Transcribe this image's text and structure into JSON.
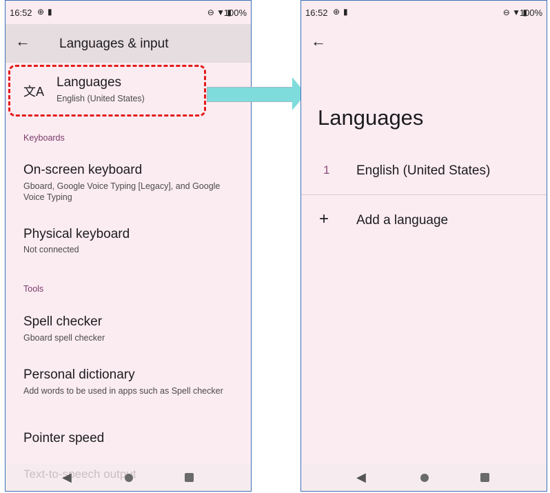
{
  "left": {
    "status": {
      "time": "16:52",
      "battery": "100%"
    },
    "appbar": {
      "title": "Languages & input"
    },
    "languages": {
      "title": "Languages",
      "subtitle": "English (United States)"
    },
    "sections": {
      "keyboards": "Keyboards",
      "tools": "Tools"
    },
    "items": [
      {
        "title": "On-screen keyboard",
        "subtitle": "Gboard, Google Voice Typing [Legacy], and Google Voice Typing"
      },
      {
        "title": "Physical keyboard",
        "subtitle": "Not connected"
      },
      {
        "title": "Spell checker",
        "subtitle": "Gboard spell checker"
      },
      {
        "title": "Personal dictionary",
        "subtitle": "Add words to be used in apps such as Spell checker"
      },
      {
        "title": "Pointer speed",
        "subtitle": ""
      }
    ],
    "partial_item": "Text-to-speech output"
  },
  "right": {
    "status": {
      "time": "16:52",
      "battery": "100%"
    },
    "page_title": "Languages",
    "languages": [
      {
        "number": "1",
        "name": "English (United States)"
      }
    ],
    "add_language": "Add a language"
  },
  "colors": {
    "highlight": "#e31b1b",
    "arrow": "#7fdcdc",
    "background": "#fbecf1"
  },
  "icons": [
    "back-arrow-icon",
    "translate-icon",
    "plus-icon",
    "wifi-icon",
    "battery-icon",
    "dnd-icon"
  ]
}
